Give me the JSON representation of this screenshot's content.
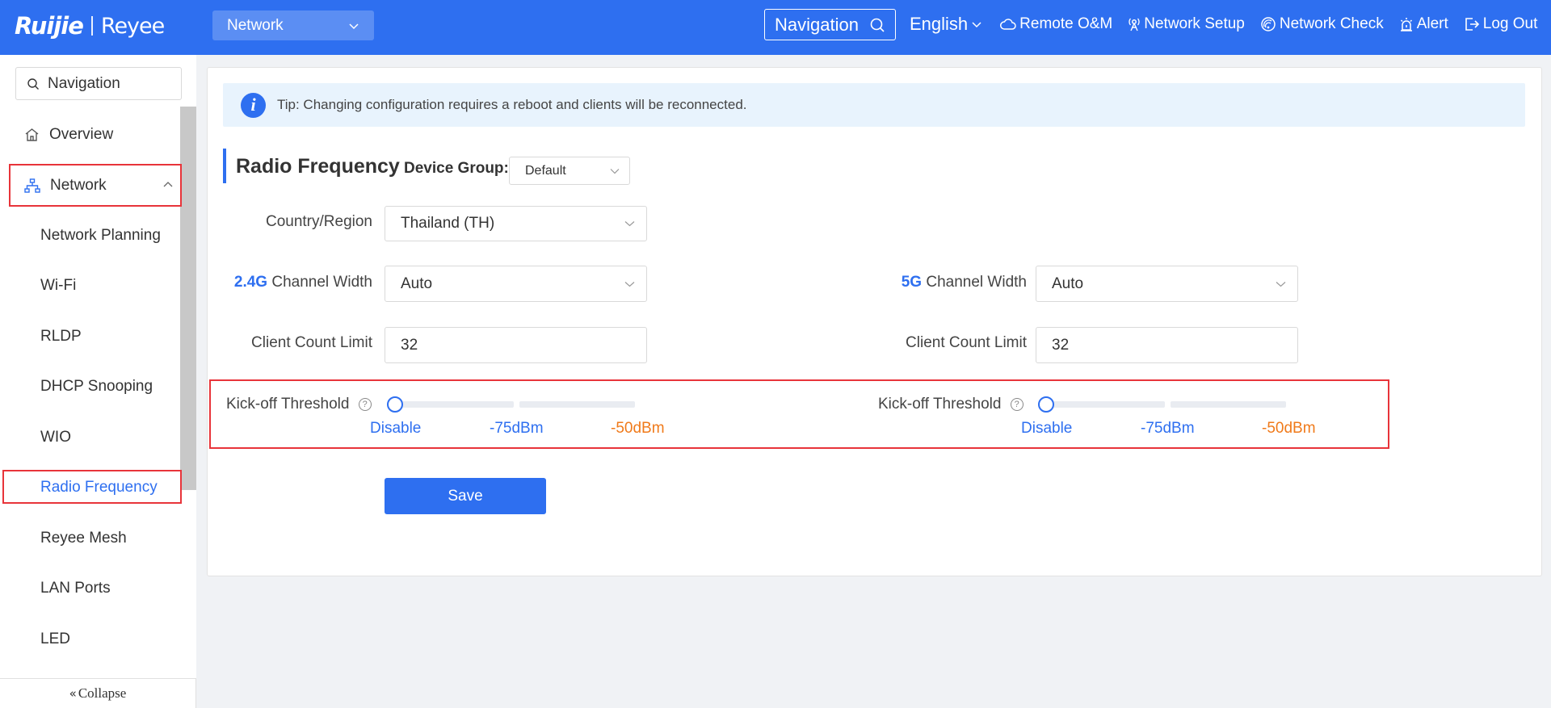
{
  "header": {
    "logo_ruijie": "Ruijie",
    "logo_reyee": "Reyee",
    "network_select": "Network",
    "navigation": "Navigation",
    "links": [
      "English",
      "Remote O&M",
      "Network Setup",
      "Network Check",
      "Alert",
      "Log Out"
    ]
  },
  "sidebar": {
    "search_placeholder": "Navigation",
    "overview": "Overview",
    "network": "Network",
    "items": [
      "Network Planning",
      "Wi-Fi",
      "RLDP",
      "DHCP Snooping",
      "WIO",
      "Radio Frequency",
      "Reyee Mesh",
      "LAN Ports",
      "LED"
    ],
    "active_item": "Radio Frequency",
    "collapse": "Collapse"
  },
  "main": {
    "tip": "Tip: Changing configuration requires a reboot and clients will be reconnected.",
    "title": "Radio Frequency",
    "device_group_label": "Device Group:",
    "device_group_value": "Default",
    "country_label": "Country/Region",
    "country_value": "Thailand (TH)",
    "band24": "2.4G",
    "band5": "5G",
    "channel_width_label": "Channel Width",
    "channel_width_24": "Auto",
    "channel_width_5": "Auto",
    "client_limit_label": "Client Count Limit",
    "client_limit_24": "32",
    "client_limit_5": "32",
    "kickoff_label": "Kick-off Threshold",
    "kickoff_marks": [
      "Disable",
      "-75dBm",
      "-50dBm"
    ],
    "kickoff_24_value": "Disable",
    "kickoff_5_value": "Disable",
    "save": "Save"
  },
  "colors": {
    "primary": "#2e6ff0",
    "highlight": "#e8343a",
    "warning": "#f07a1a"
  }
}
